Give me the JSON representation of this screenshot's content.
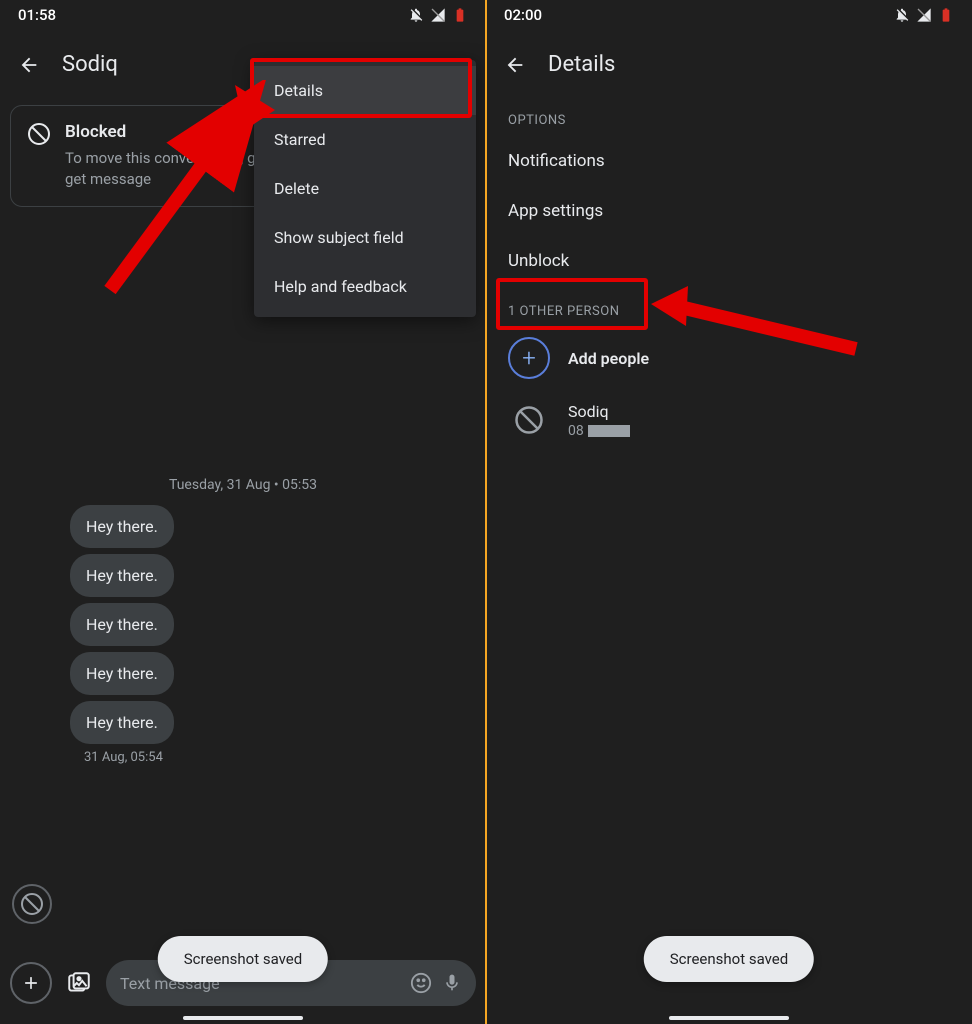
{
  "left": {
    "status": {
      "time": "01:58"
    },
    "header": {
      "title": "Sodiq"
    },
    "blocked": {
      "title": "Blocked",
      "subtitle": "To move this conversation, go to 'Spam and blocked' and get message"
    },
    "menu": {
      "items": [
        "Details",
        "Starred",
        "Delete",
        "Show subject field",
        "Help and feedback"
      ]
    },
    "timestamp": "Tuesday, 31 Aug • 05:53",
    "messages": [
      "Hey there.",
      "Hey there.",
      "Hey there.",
      "Hey there.",
      "Hey there."
    ],
    "message_time": "31 Aug, 05:54",
    "input_placeholder": "Text message",
    "toast": "Screenshot saved"
  },
  "right": {
    "status": {
      "time": "02:00"
    },
    "header": {
      "title": "Details"
    },
    "section_options": "OPTIONS",
    "options": [
      "Notifications",
      "App settings",
      "Unblock"
    ],
    "section_people": "1 OTHER PERSON",
    "add_people": "Add people",
    "contact": {
      "name": "Sodiq",
      "number_prefix": "08"
    },
    "toast": "Screenshot saved"
  }
}
